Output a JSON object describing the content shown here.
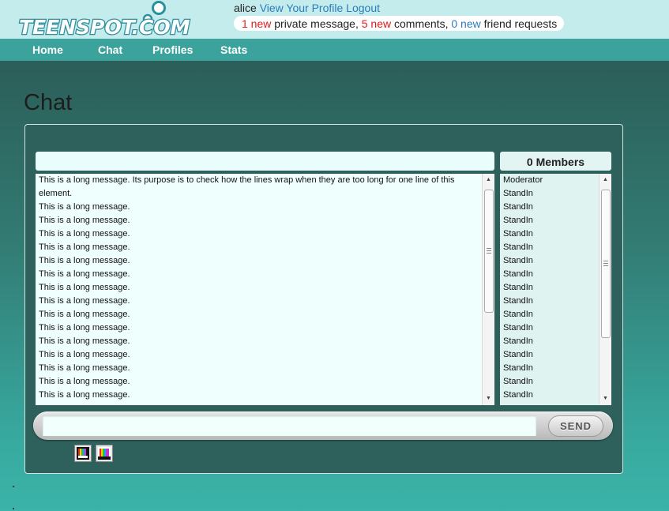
{
  "header": {
    "logo_text": "TEENSPOT.COM",
    "username": "alice",
    "view_profile_link": "View Your Profile",
    "logout_link": "Logout",
    "notifications": {
      "private_messages_count": "1 new",
      "private_messages_label": "private message,",
      "comments_count": "5 new",
      "comments_label": "comments,",
      "friend_requests_count": "0 new",
      "friend_requests_label": "friend requests"
    }
  },
  "nav": [
    {
      "label": "Home"
    },
    {
      "label": "Chat"
    },
    {
      "label": "Profiles"
    },
    {
      "label": "Stats"
    }
  ],
  "page": {
    "title": "Chat"
  },
  "chat": {
    "topic": "",
    "members_header": "0 Members",
    "messages": [
      "This is a long message. Its purpose is to check how the lines wrap when they are too long for one line of this element.",
      "This is a long message.",
      "This is a long message.",
      "This is a long message.",
      "This is a long message.",
      "This is a long message.",
      "This is a long message.",
      "This is a long message.",
      "This is a long message.",
      "This is a long message.",
      "This is a long message.",
      "This is a long message.",
      "This is a long message.",
      "This is a long message.",
      "This is a long message.",
      "This is a long message."
    ],
    "members": [
      "Moderator",
      "StandIn",
      "StandIn",
      "StandIn",
      "StandIn",
      "StandIn",
      "StandIn",
      "StandIn",
      "StandIn",
      "StandIn",
      "StandIn",
      "StandIn",
      "StandIn",
      "StandIn",
      "StandIn",
      "StandIn",
      "StandIn"
    ],
    "input": {
      "value": "",
      "placeholder": ""
    },
    "send_label": "SEND",
    "color_buttons": [
      {
        "icon": "text-color-icon"
      },
      {
        "icon": "background-color-icon"
      }
    ]
  },
  "colors": {
    "topbar": "#c5eced",
    "navbar": "#3ba39b",
    "accent_red": "#e21a1a",
    "accent_blue": "#2a7dbd",
    "panel": "#2e615c",
    "message_bg": "#effffd"
  }
}
